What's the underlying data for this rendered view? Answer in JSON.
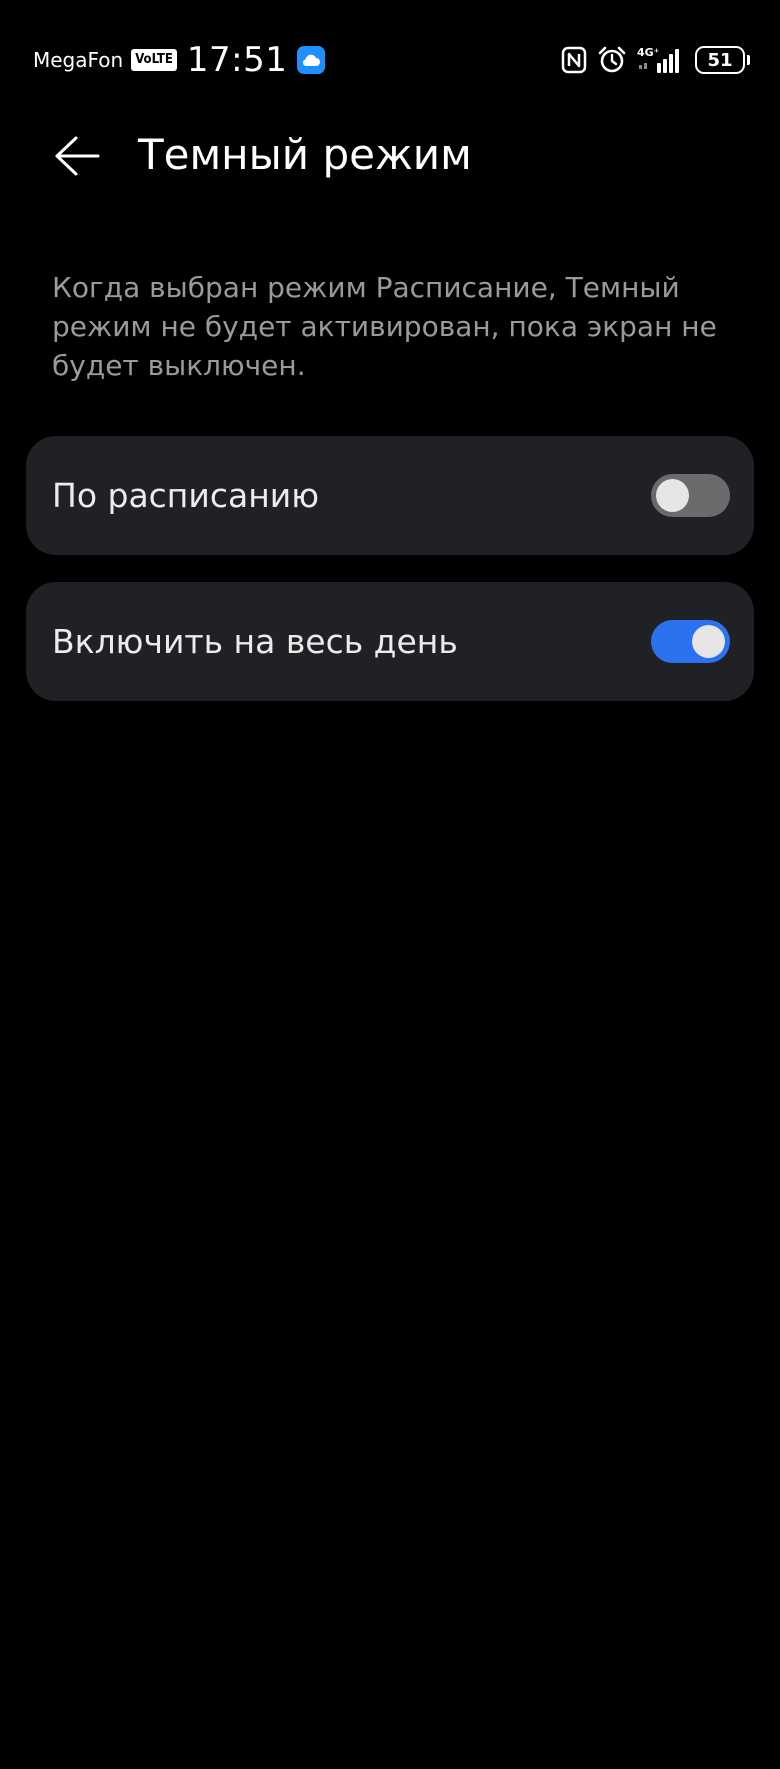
{
  "status_bar": {
    "carrier": "MegaFon",
    "volte_badge": "VoLTE",
    "time": "17:51",
    "cloud_icon": "cloud-icon",
    "nfc_icon": "nfc-icon",
    "alarm_icon": "alarm-icon",
    "network_type": "4G⁺",
    "signal_icon": "signal-icon",
    "battery_level": "51"
  },
  "header": {
    "back_icon": "back-arrow-icon",
    "title": "Темный режим"
  },
  "description": "Когда выбран режим Расписание, Темный режим не будет активирован, пока экран не будет выключен.",
  "settings": [
    {
      "label": "По расписанию",
      "enabled": false
    },
    {
      "label": "Включить на весь день",
      "enabled": true
    }
  ],
  "colors": {
    "background": "#000000",
    "card": "#202124",
    "accent": "#2c72f0",
    "toggle_off": "#6b6b6d",
    "description_text": "#9a9a9a"
  }
}
